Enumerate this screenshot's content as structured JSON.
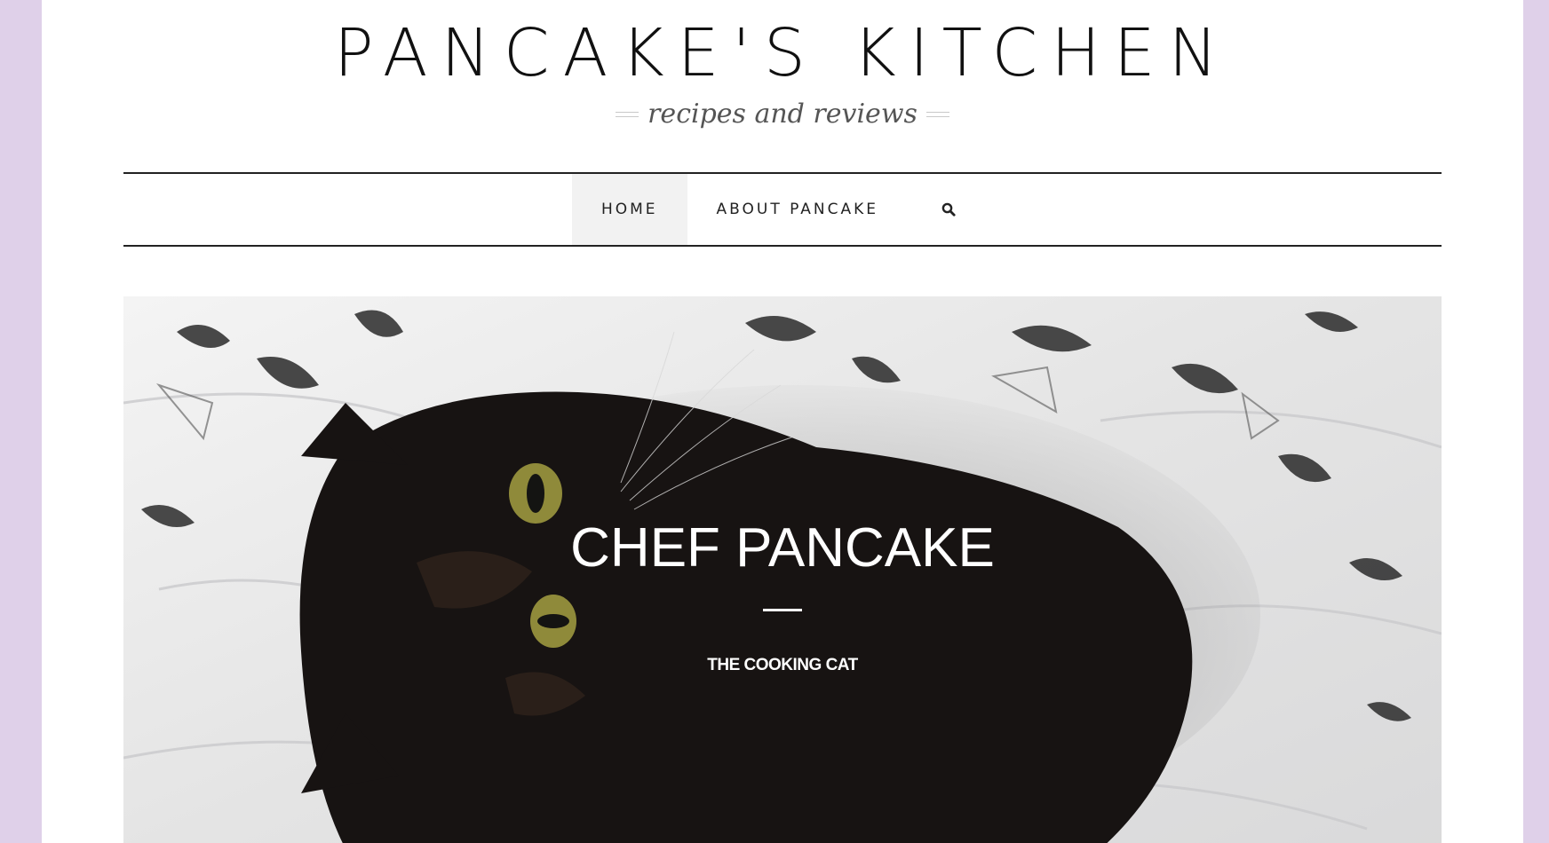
{
  "site": {
    "title": "PANCAKE'S KITCHEN",
    "tagline": "recipes and reviews"
  },
  "nav": {
    "items": [
      {
        "label": "HOME",
        "active": true
      },
      {
        "label": "ABOUT PANCAKE",
        "active": false
      }
    ],
    "search_icon": "search-icon"
  },
  "hero": {
    "image": "black-cat-on-butterfly-bedsheet",
    "title": "CHEF PANCAKE",
    "subtitle": "THE COOKING CAT"
  },
  "colors": {
    "page_background": "#dfd0e9",
    "content_background": "#ffffff",
    "text": "#111111",
    "nav_active_background": "#f2f2f2"
  }
}
